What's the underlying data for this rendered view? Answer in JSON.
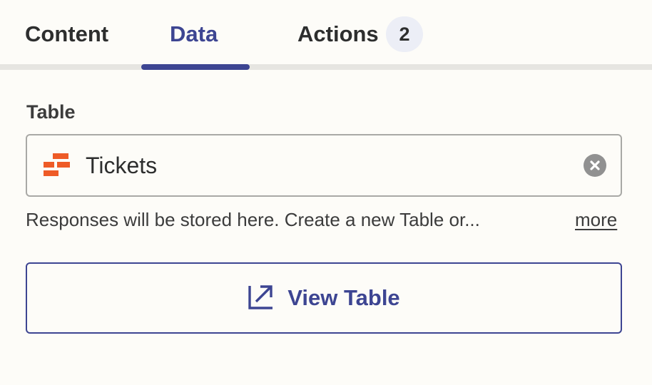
{
  "tabs": [
    {
      "label": "Content",
      "active": false
    },
    {
      "label": "Data",
      "active": true
    },
    {
      "label": "Actions",
      "active": false,
      "badge": "2"
    }
  ],
  "table_field": {
    "label": "Table",
    "value": "Tickets",
    "icon": "table-icon",
    "helper_text": "Responses will be stored here. Create a new Table or...",
    "more_label": "more"
  },
  "view_button": {
    "label": "View Table",
    "icon": "external-link-icon"
  },
  "colors": {
    "accent": "#3d4592",
    "icon_orange": "#ee5b27",
    "background": "#fdfcf8"
  }
}
